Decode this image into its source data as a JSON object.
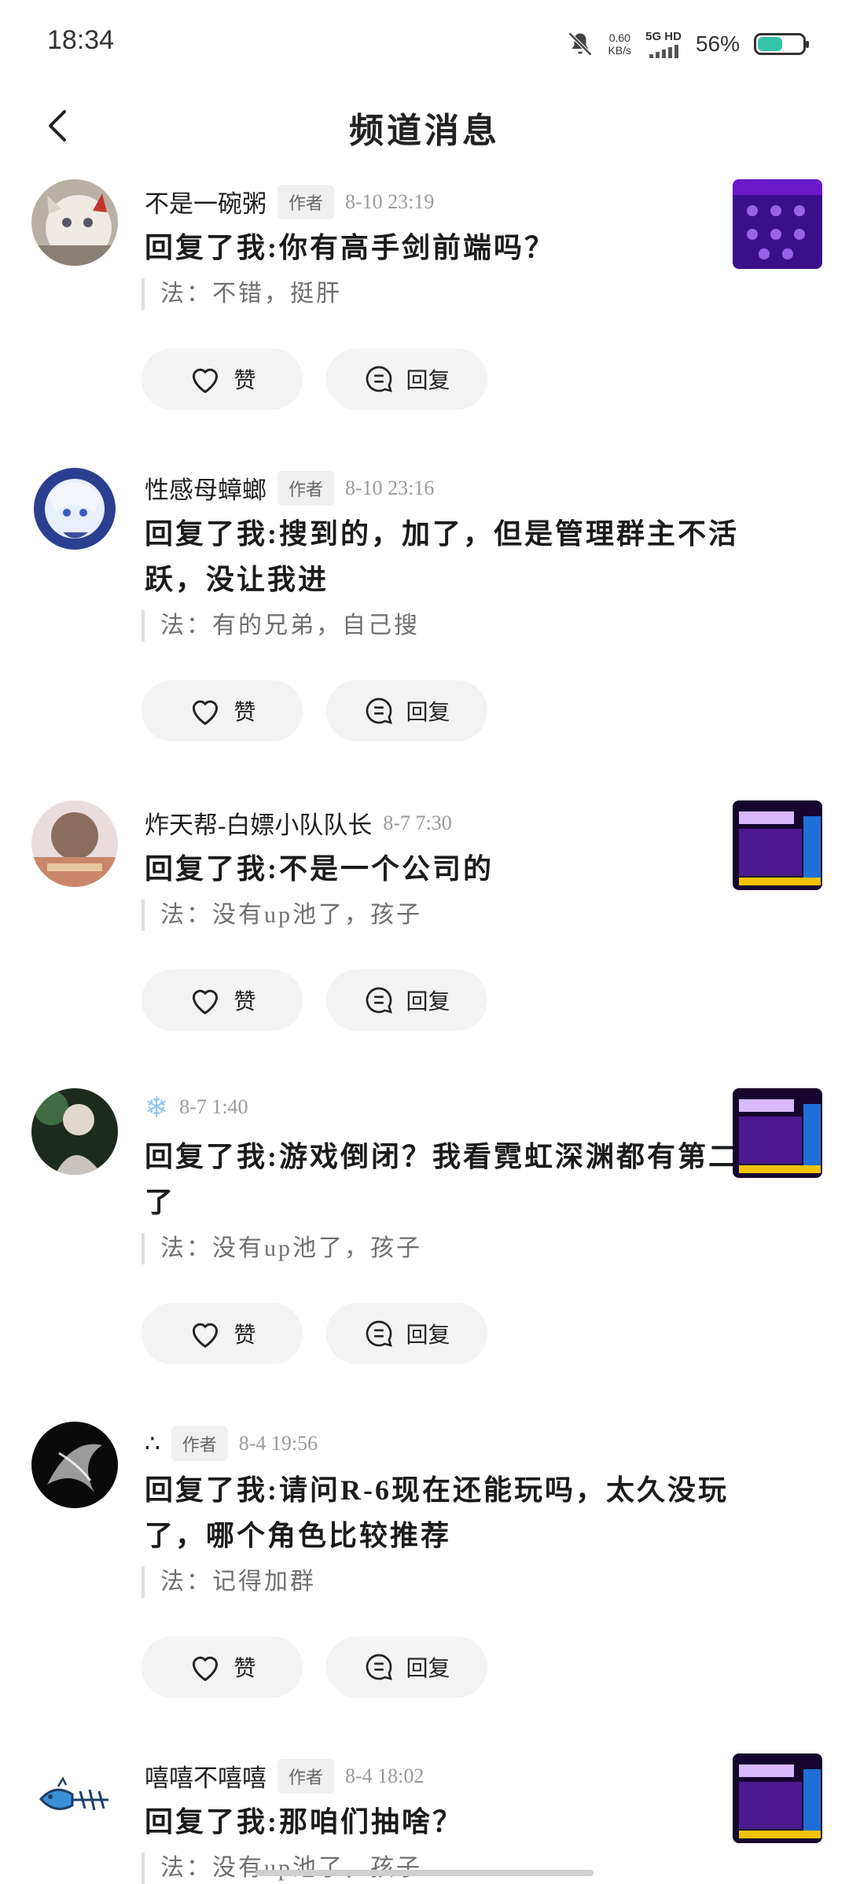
{
  "status_bar": {
    "time": "18:34",
    "net_speed_value": "0.60",
    "net_speed_unit": "KB/s",
    "network": "5G HD",
    "battery_percent": "56%",
    "battery_level": 0.56
  },
  "header": {
    "title": "频道消息"
  },
  "buttons": {
    "like_label": "赞",
    "reply_label": "回复"
  },
  "messages": [
    {
      "username": "不是一碗粥",
      "badge": "作者",
      "time": "8-10 23:19",
      "text": "回复了我:你有高手剑前端吗？",
      "quote": "法：不错，挺肝",
      "has_thumb": true
    },
    {
      "username": "性感母蟑螂",
      "badge": "作者",
      "time": "8-10 23:16",
      "text": "回复了我:搜到的，加了，但是管理群主不活跃，没让我进",
      "quote": "法：有的兄弟，自己搜",
      "has_thumb": false
    },
    {
      "username": "炸天帮-白嫖小队队长",
      "badge": "",
      "time": "8-7 7:30",
      "text": "回复了我:不是一个公司的",
      "quote": "法：没有up池了，孩子",
      "has_thumb": true
    },
    {
      "username": "❄",
      "badge": "",
      "time": "8-7 1:40",
      "text": "回复了我:游戏倒闭？我看霓虹深渊都有第二部了",
      "quote": "法：没有up池了，孩子",
      "has_thumb": true
    },
    {
      "username": "∴",
      "badge": "作者",
      "time": "8-4 19:56",
      "text": "回复了我:请问R-6现在还能玩吗，太久没玩了，哪个角色比较推荐",
      "quote": "法：记得加群",
      "has_thumb": false
    },
    {
      "username": "嘻嘻不嘻嘻",
      "badge": "作者",
      "time": "8-4 18:02",
      "text": "回复了我:那咱们抽啥？",
      "quote": "法：没有up池了，孩子",
      "has_thumb": true
    }
  ]
}
